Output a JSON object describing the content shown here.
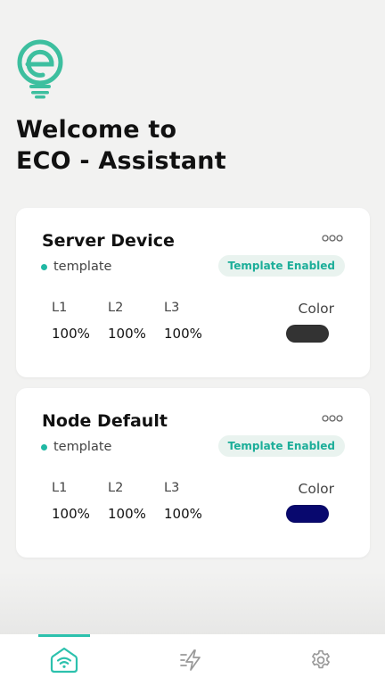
{
  "header": {
    "logo_icon": "eco-bulb-logo",
    "welcome_line1": "Welcome to",
    "welcome_line2": "ECO - Assistant"
  },
  "accent_color": "#2cc1ad",
  "devices": [
    {
      "name": "Server Device",
      "tag": "template",
      "badge": "Template Enabled",
      "levels": [
        {
          "label": "L1",
          "value": "100%"
        },
        {
          "label": "L2",
          "value": "100%"
        },
        {
          "label": "L3",
          "value": "100%"
        }
      ],
      "color_label": "Color",
      "color": "#333333"
    },
    {
      "name": "Node Default",
      "tag": "template",
      "badge": "Template Enabled",
      "levels": [
        {
          "label": "L1",
          "value": "100%"
        },
        {
          "label": "L2",
          "value": "100%"
        },
        {
          "label": "L3",
          "value": "100%"
        }
      ],
      "color_label": "Color",
      "color": "#08086e"
    }
  ],
  "tabbar": {
    "tabs": [
      {
        "icon": "home-wifi-icon",
        "active": true
      },
      {
        "icon": "lightning-icon",
        "active": false
      },
      {
        "icon": "settings-icon",
        "active": false
      }
    ]
  }
}
